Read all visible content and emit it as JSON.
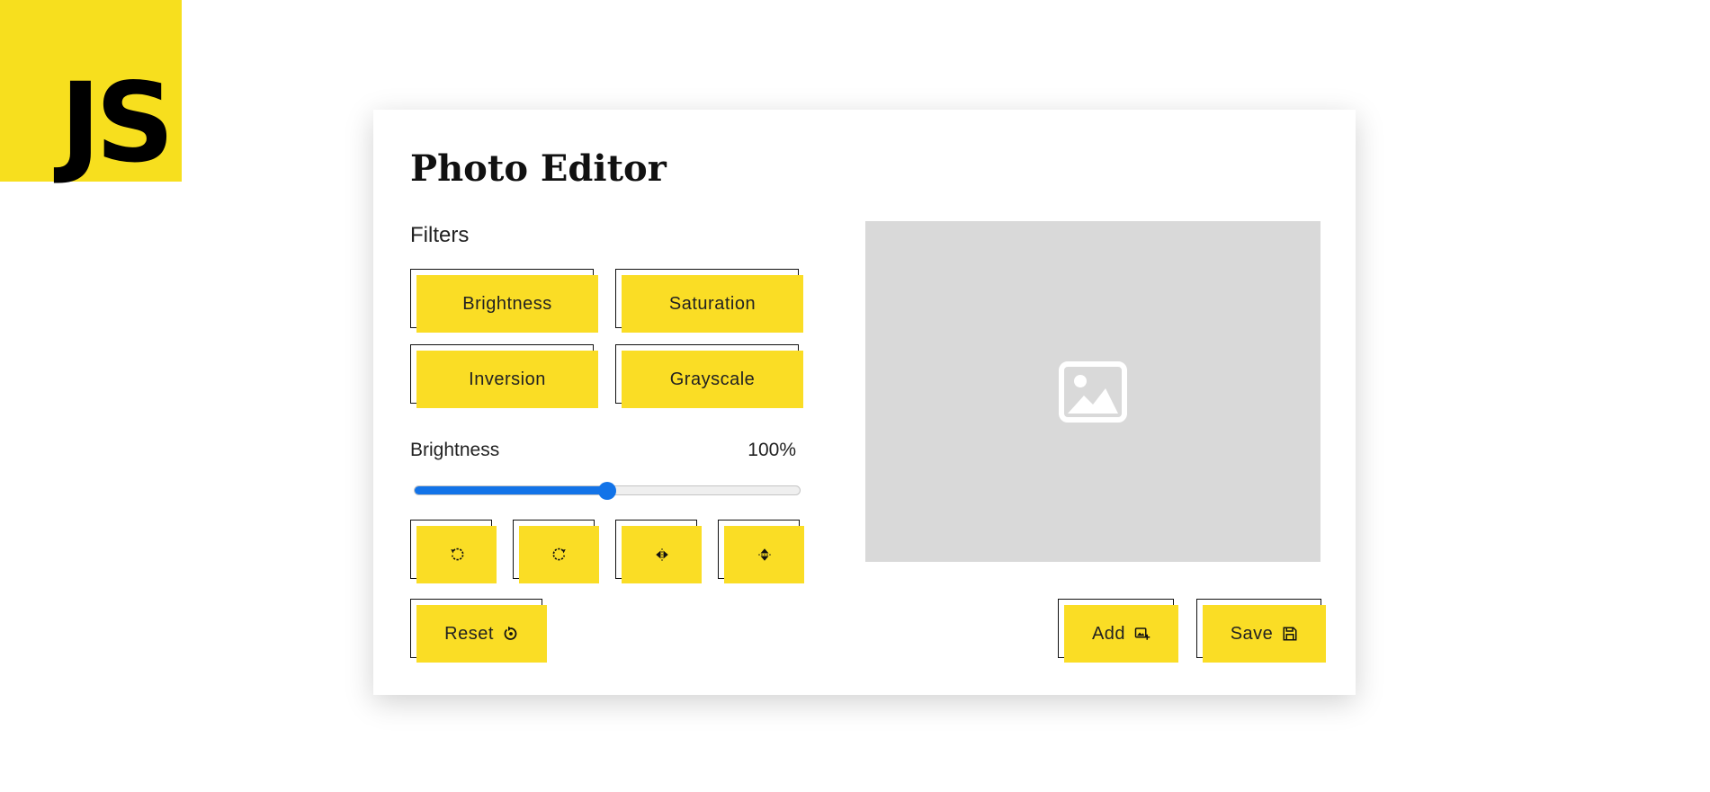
{
  "logo": {
    "text": "JS",
    "color": "#f7df1e"
  },
  "editor": {
    "title": "Photo Editor",
    "filters_label": "Filters",
    "filters": [
      {
        "label": "Brightness"
      },
      {
        "label": "Saturation"
      },
      {
        "label": "Inversion"
      },
      {
        "label": "Grayscale"
      }
    ],
    "slider": {
      "label": "Brightness",
      "value_text": "100%",
      "level_fraction": 0.5,
      "accent": "#1273e8"
    },
    "tools": [
      {
        "icon": "rotate-left-icon"
      },
      {
        "icon": "rotate-right-icon"
      },
      {
        "icon": "flip-horizontal-icon"
      },
      {
        "icon": "flip-vertical-icon"
      }
    ],
    "reset_label": "Reset",
    "reset_icon": "reset-icon",
    "add_label": "Add",
    "add_icon": "add-image-icon",
    "save_label": "Save",
    "save_icon": "save-icon",
    "preview_icon": "image-placeholder-icon",
    "button_color": "#fadd25"
  }
}
